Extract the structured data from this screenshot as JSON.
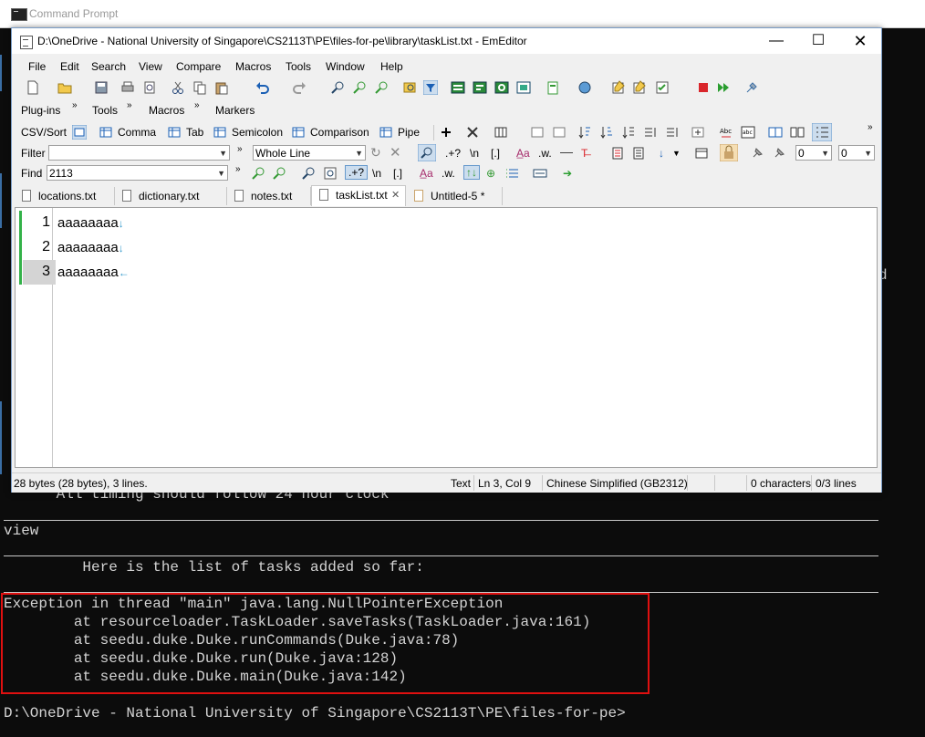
{
  "console": {
    "window_title": "Command Prompt",
    "timing_line": "     *All timing should follow 24 hour clock",
    "command": "view",
    "list_line": "         Here is the list of tasks added so far:",
    "error_lines": [
      "Exception in thread \"main\" java.lang.NullPointerException",
      "        at resourceloader.TaskLoader.saveTasks(TaskLoader.java:161)",
      "        at seedu.duke.Duke.runCommands(Duke.java:78)",
      "        at seedu.duke.Duke.run(Duke.java:128)",
      "        at seedu.duke.Duke.main(Duke.java:142)"
    ],
    "prompt": "D:\\OneDrive - National University of Singapore\\CS2113T\\PE\\files-for-pe>",
    "stray_char": "d"
  },
  "editor": {
    "window_title": "D:\\OneDrive - National University of Singapore\\CS2113T\\PE\\files-for-pe\\library\\taskList.txt - EmEditor",
    "menu": [
      "File",
      "Edit",
      "Search",
      "View",
      "Compare",
      "Macros",
      "Tools",
      "Window",
      "Help"
    ],
    "toolbar_row2": {
      "plugins": "Plug-ins",
      "tools": "Tools",
      "macros": "Macros",
      "markers": "Markers"
    },
    "csv_row": {
      "csv_sort": "CSV/Sort",
      "comma": "Comma",
      "tab": "Tab",
      "semicolon": "Semicolon",
      "comparison": "Comparison",
      "pipe": "Pipe"
    },
    "filter_row": {
      "label": "Filter",
      "value": "",
      "mode": "Whole Line",
      "regex": ".+?",
      "newline": "\\n",
      "brackets": "[.]",
      "num1": "0",
      "num2": "0"
    },
    "find_row": {
      "label": "Find",
      "value": "2113",
      "regex": ".+?",
      "newline": "\\n",
      "brackets": "[.]"
    },
    "tabs": [
      "locations.txt",
      "dictionary.txt",
      "notes.txt",
      "taskList.txt",
      "Untitled-5 *"
    ],
    "active_tab": 3,
    "lines": [
      {
        "num": "1",
        "text": "aaaaaaaa",
        "eol": "↓"
      },
      {
        "num": "2",
        "text": "aaaaaaaa",
        "eol": "↓"
      },
      {
        "num": "3",
        "text": "aaaaaaaa",
        "eol": "←"
      }
    ],
    "status": {
      "size": "28 bytes (28 bytes), 3 lines.",
      "mode": "Text",
      "position": "Ln 3, Col 9",
      "encoding": "Chinese Simplified (GB2312)",
      "selection": "0 characters",
      "lines_sel": "0/3 lines"
    }
  },
  "colors": {
    "error_box": "#e01010",
    "line_marker": "#33b249",
    "console_bg": "#0c0c0c"
  }
}
